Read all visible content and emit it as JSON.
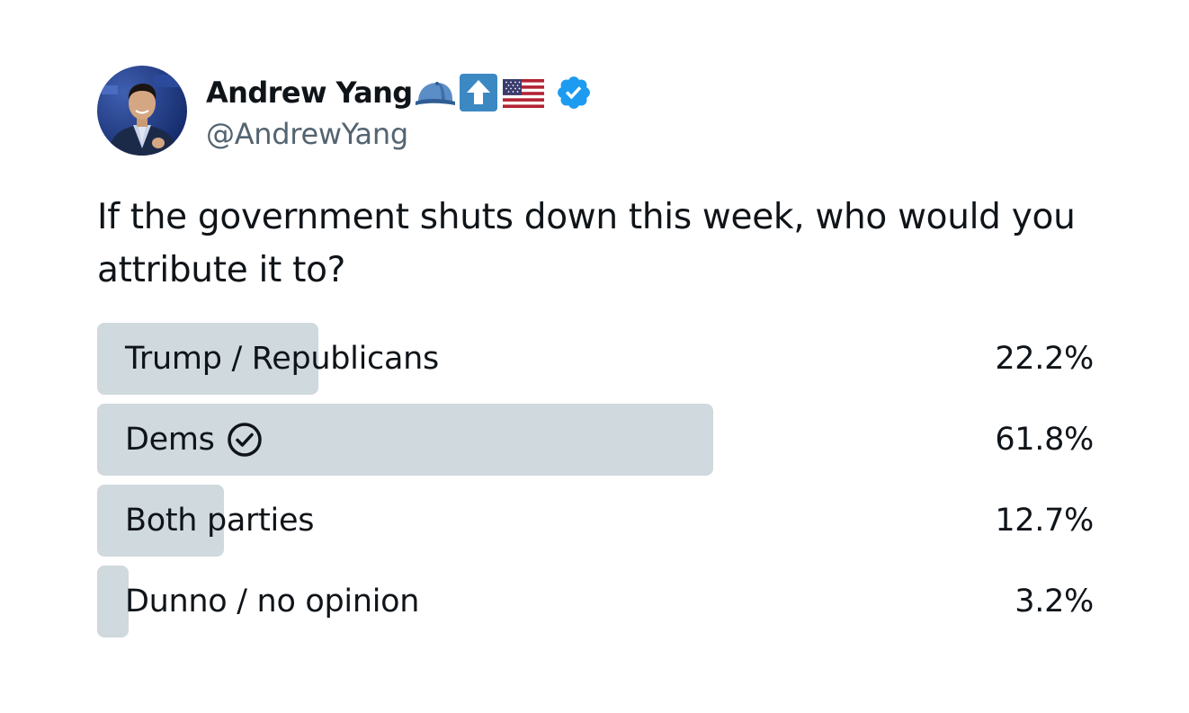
{
  "author": {
    "display_name": "Andrew Yang",
    "handle": "@AndrewYang",
    "avatar_icon": "andrew-yang-avatar",
    "name_emojis": [
      "blue-cap-icon",
      "up-arrow-icon",
      "us-flag-icon"
    ],
    "verified_icon": "verified-badge-icon",
    "verified_color": "#1d9bf0"
  },
  "tweet": {
    "text": "If the government shuts down this week, who would you attribute it to?"
  },
  "poll": {
    "bar_color": "#cfd9de",
    "options": [
      {
        "label": "Trump / Republicans",
        "percent_text": "22.2%",
        "fraction": 0.222,
        "selected": false
      },
      {
        "label": "Dems",
        "percent_text": "61.8%",
        "fraction": 0.618,
        "selected": true,
        "selected_icon": "check-circle-icon"
      },
      {
        "label": "Both parties",
        "percent_text": "12.7%",
        "fraction": 0.127,
        "selected": false
      },
      {
        "label": "Dunno / no opinion",
        "percent_text": "3.2%",
        "fraction": 0.032,
        "selected": false
      }
    ]
  }
}
